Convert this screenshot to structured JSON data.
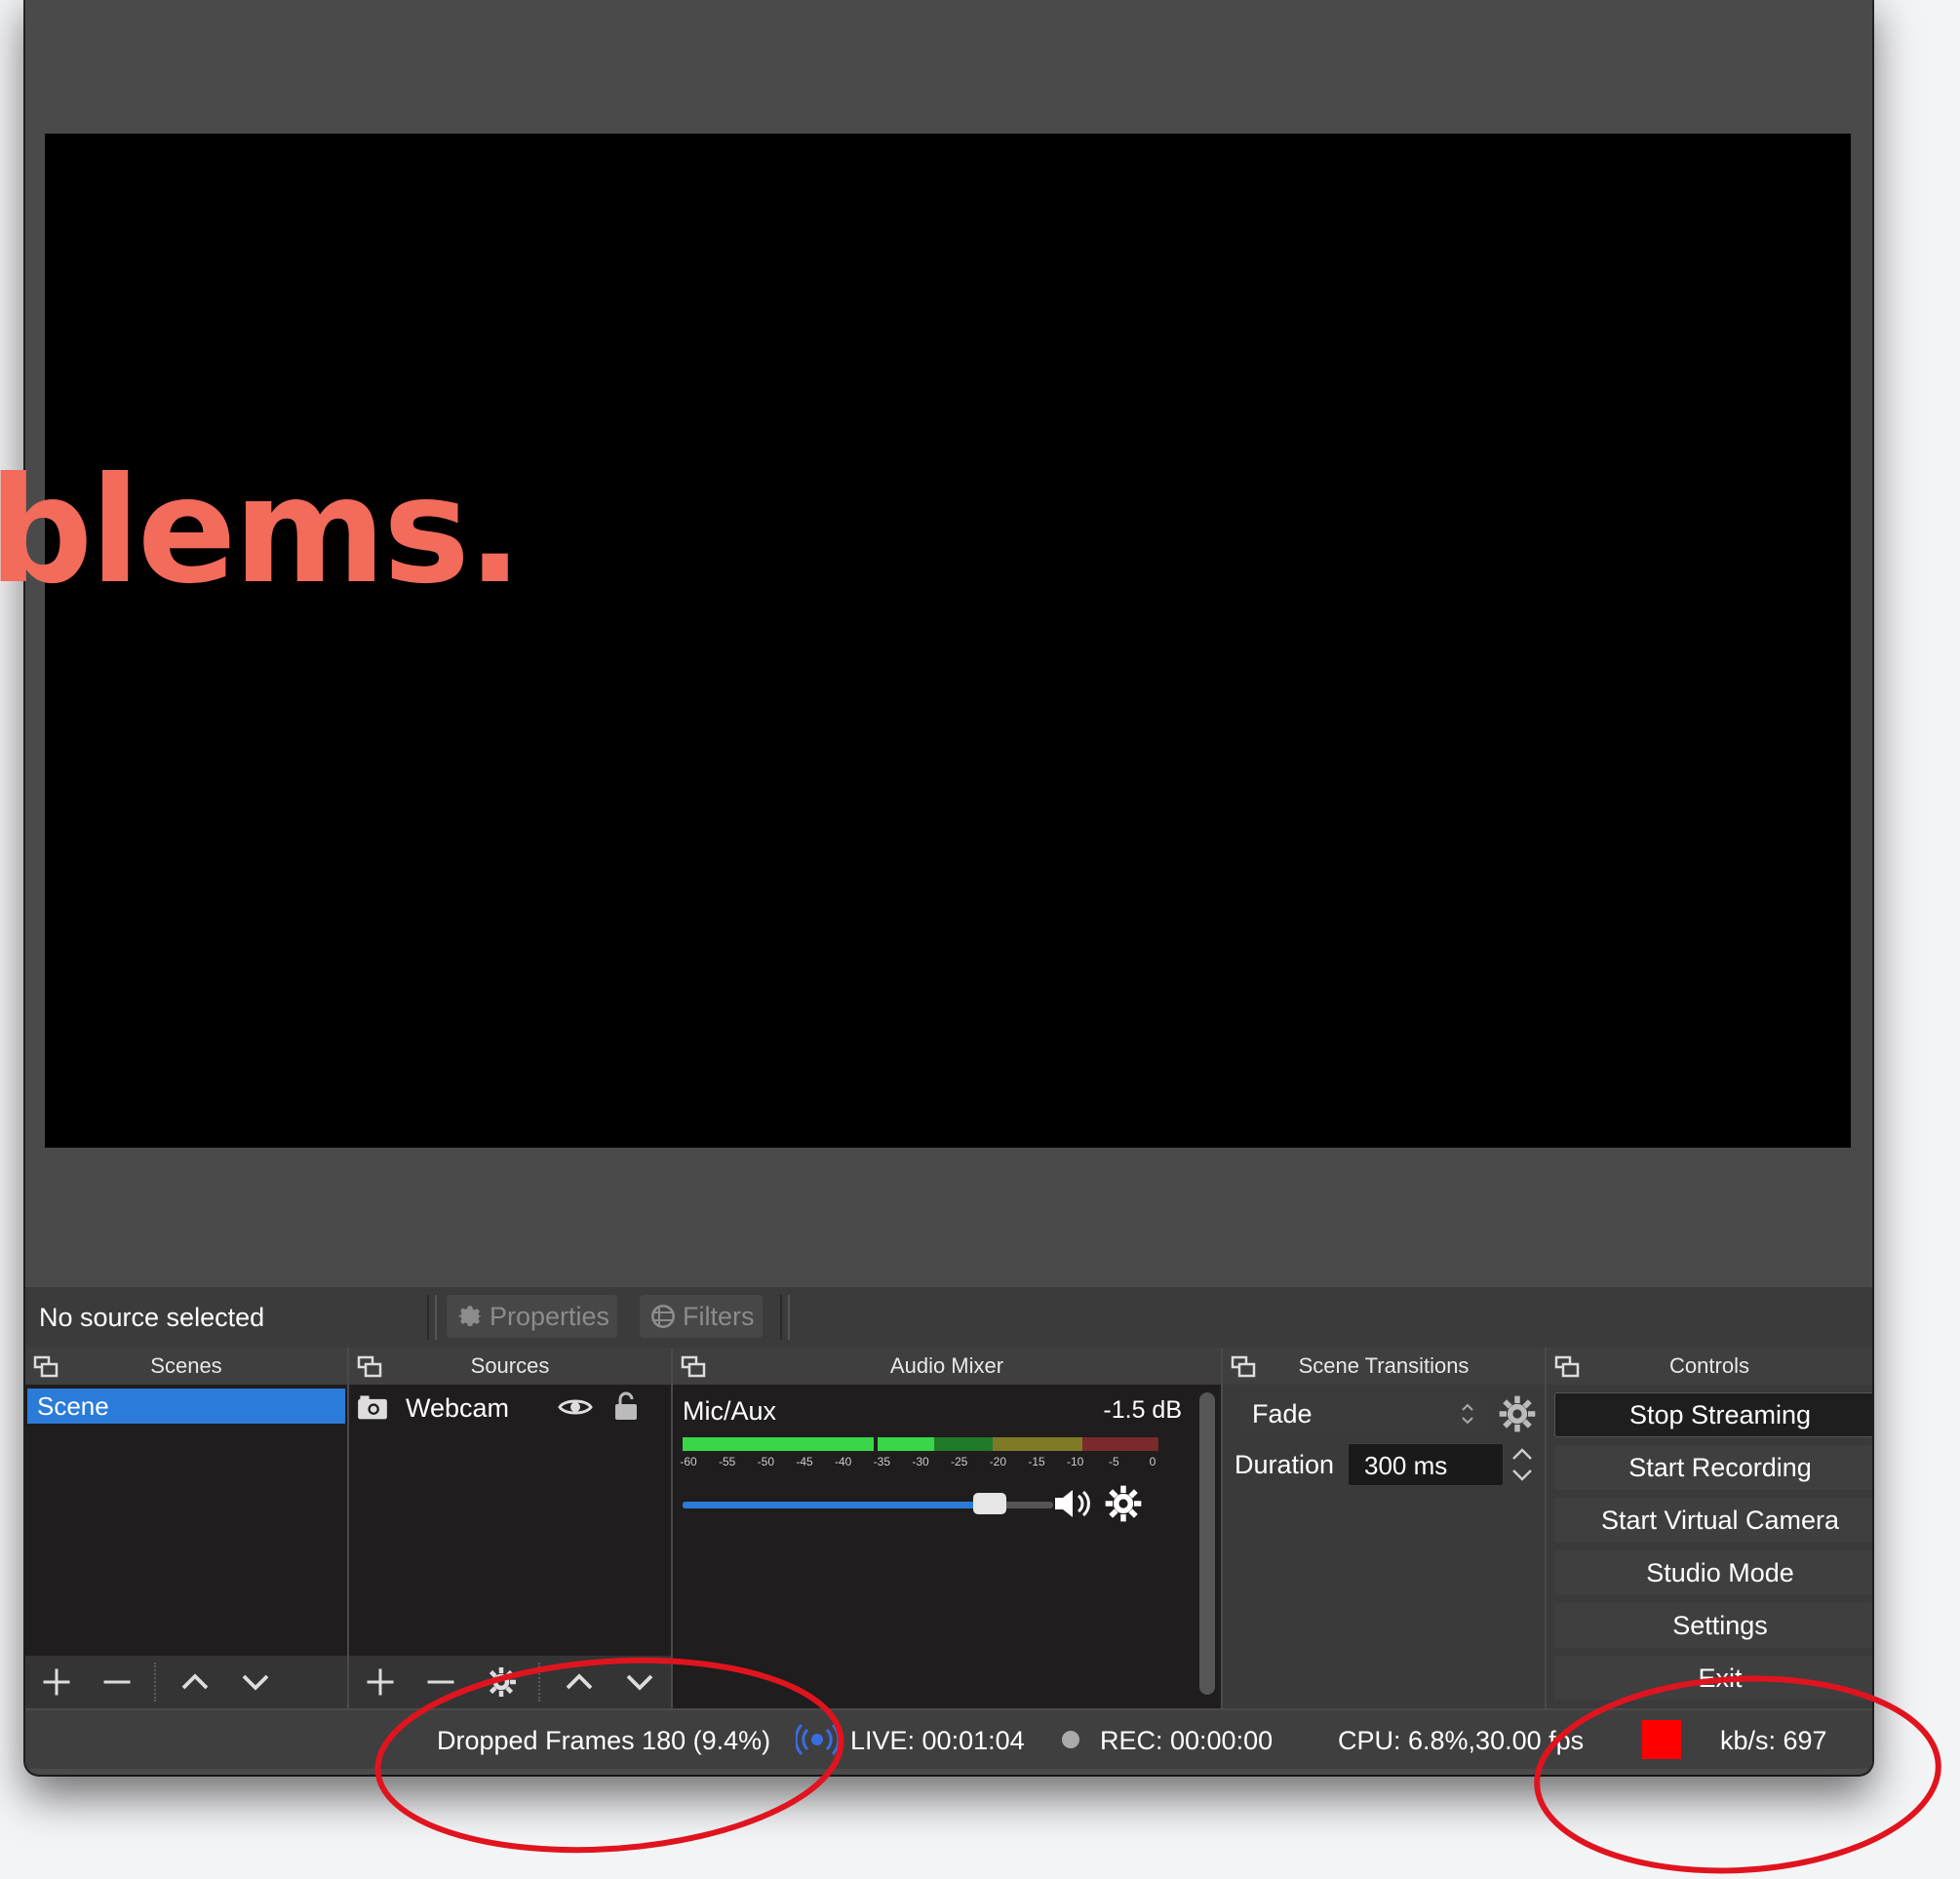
{
  "headline": "blems.",
  "source_bar": {
    "no_source": "No source selected",
    "properties_label": "Properties",
    "filters_label": "Filters"
  },
  "docks": {
    "scenes": {
      "title": "Scenes",
      "items": [
        "Scene"
      ]
    },
    "sources": {
      "title": "Sources",
      "items": [
        {
          "label": "Webcam",
          "icon": "camera-icon"
        }
      ]
    },
    "audio_mixer": {
      "title": "Audio Mixer",
      "channel": "Mic/Aux",
      "db": "-1.5 dB",
      "ticks": [
        "-60",
        "-55",
        "-50",
        "-45",
        "-40",
        "-35",
        "-30",
        "-25",
        "-20",
        "-15",
        "-10",
        "-5",
        "0"
      ],
      "volume_level": 0.83
    },
    "scene_transitions": {
      "title": "Scene Transitions",
      "transition": "Fade",
      "duration_label": "Duration",
      "duration_value": "300 ms"
    },
    "controls": {
      "title": "Controls",
      "buttons": [
        "Stop Streaming",
        "Start Recording",
        "Start Virtual Camera",
        "Studio Mode",
        "Settings",
        "Exit"
      ]
    }
  },
  "status": {
    "dropped_frames": "Dropped Frames 180 (9.4%)",
    "live": "LIVE: 00:01:04",
    "rec": "REC: 00:00:00",
    "cpu": "CPU: 6.8%,30.00 fps",
    "kbps": "kb/s: 697"
  },
  "colors": {
    "accent": "#2b7bd9",
    "headline": "#f26b5b",
    "annotation": "#e0141e",
    "bitrate_indicator": "#ff0000"
  }
}
